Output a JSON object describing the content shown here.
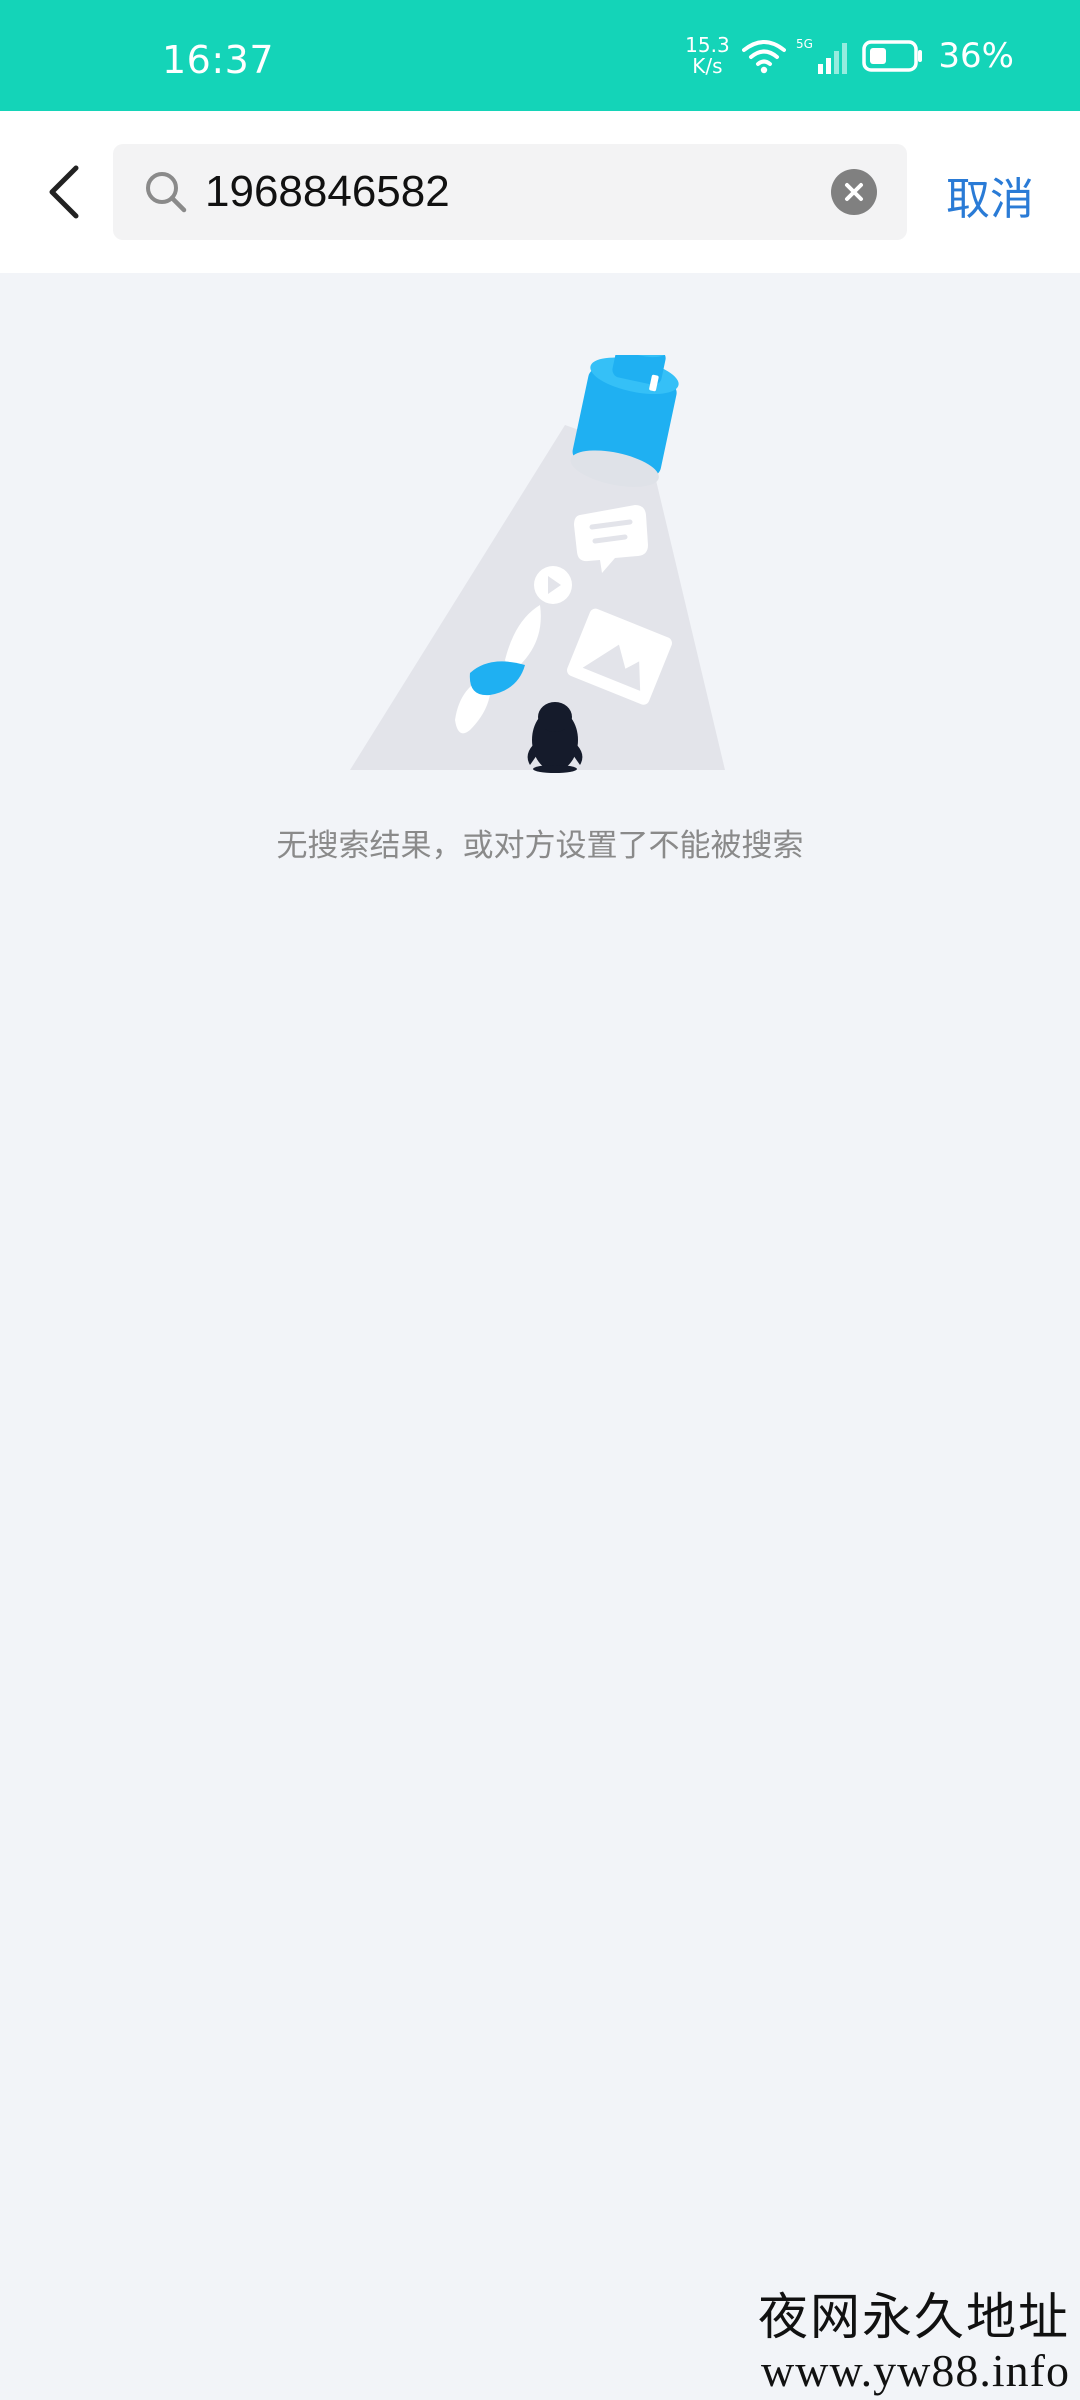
{
  "status_bar": {
    "time": "16:37",
    "net_speed_value": "15.3",
    "net_speed_unit": "K/s",
    "network_type": "5G",
    "battery_percent": "36%",
    "background_color": "#14d4b8"
  },
  "search": {
    "query": "1968846582",
    "cancel_label": "取消",
    "icons": {
      "back": "chevron-left-icon",
      "search": "search-icon",
      "clear": "clear-circle-icon"
    }
  },
  "empty_state": {
    "message": "无搜索结果，或对方设置了不能被搜索",
    "illustration": "flashlight-penguin-illustration",
    "accent_color": "#1fb0f2"
  },
  "watermark": {
    "title": "夜网永久地址",
    "url": "www.yw88.info"
  }
}
